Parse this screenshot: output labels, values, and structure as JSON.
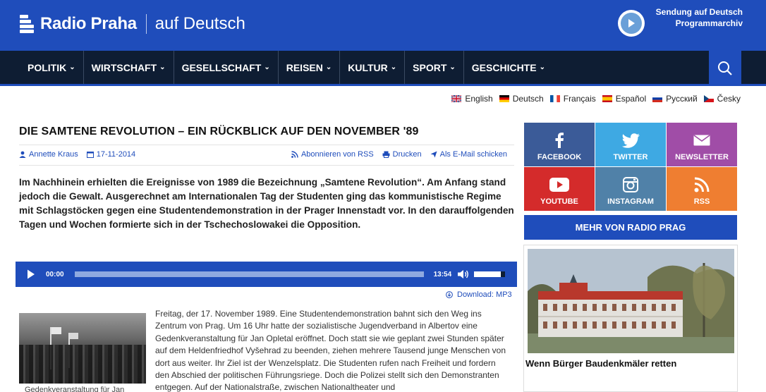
{
  "header": {
    "logo_name": "Radio Praha",
    "logo_sub": "auf Deutsch",
    "links": [
      "Sendung auf Deutsch",
      "Programmarchiv"
    ]
  },
  "nav": {
    "items": [
      "POLITIK",
      "WIRTSCHAFT",
      "GESELLSCHAFT",
      "REISEN",
      "KULTUR",
      "SPORT",
      "GESCHICHTE"
    ]
  },
  "languages": [
    "English",
    "Deutsch",
    "Français",
    "Español",
    "Русский",
    "Česky"
  ],
  "article": {
    "title": "DIE SAMTENE REVOLUTION – EIN RÜCKBLICK AUF DEN NOVEMBER '89",
    "author": "Annette Kraus",
    "date": "17-11-2014",
    "actions": [
      "Abonnieren von RSS",
      "Drucken",
      "Als E-Mail schicken"
    ],
    "lead": "Im Nachhinein erhielten die Ereignisse von 1989 die Bezeichnung „Samtene Revolution“. Am Anfang stand jedoch die Gewalt. Ausgerechnet am Internationalen Tag der Studenten ging das kommunistische Regime mit Schlagstöcken gegen eine Studentendemonstration in der Prager Innenstadt vor. In den darauffolgenden Tagen und Wochen formierte sich in der Tschechoslowakei die Opposition.",
    "player": {
      "current": "00:00",
      "duration": "13:54",
      "progress": 0,
      "volume": 0.85
    },
    "download": "Download: MP3",
    "caption": "Gedenkveranstaltung für Jan",
    "body": "Freitag, der 17. November 1989. Eine Studentendemonstration bahnt sich den Weg ins Zentrum von Prag. Um 16 Uhr hatte der sozialistische Jugendverband in Albertov eine Gedenkveranstaltung für Jan Opletal eröffnet. Doch statt sie wie geplant zwei Stunden später auf dem Heldenfriedhof Vyšehrad zu beenden, ziehen mehrere Tausend junge Menschen von dort aus weiter. Ihr Ziel ist der Wenzelsplatz. Die Studenten rufen nach Freiheit und fordern den Abschied der politischen Führungsriege. Doch die Polizei stellt sich den Demonstranten entgegen. Auf der Nationalstraße, zwischen Nationaltheater und"
  },
  "sidebar": {
    "social": [
      {
        "label": "FACEBOOK",
        "icon": "facebook-icon",
        "color": "#3b5b98"
      },
      {
        "label": "TWITTER",
        "icon": "twitter-icon",
        "color": "#3ea9e3"
      },
      {
        "label": "NEWSLETTER",
        "icon": "envelope-icon",
        "color": "#a04da7"
      },
      {
        "label": "YOUTUBE",
        "icon": "youtube-icon",
        "color": "#d42b2b"
      },
      {
        "label": "INSTAGRAM",
        "icon": "instagram-icon",
        "color": "#5081a8"
      },
      {
        "label": "RSS",
        "icon": "rss-icon",
        "color": "#ef7e31"
      }
    ],
    "more_button": "MEHR VON RADIO PRAG",
    "teaser_title": "Wenn Bürger Baudenkmäler retten"
  },
  "colors": {
    "brand": "#1f4dbb",
    "nav_bg": "#0e1d33"
  }
}
